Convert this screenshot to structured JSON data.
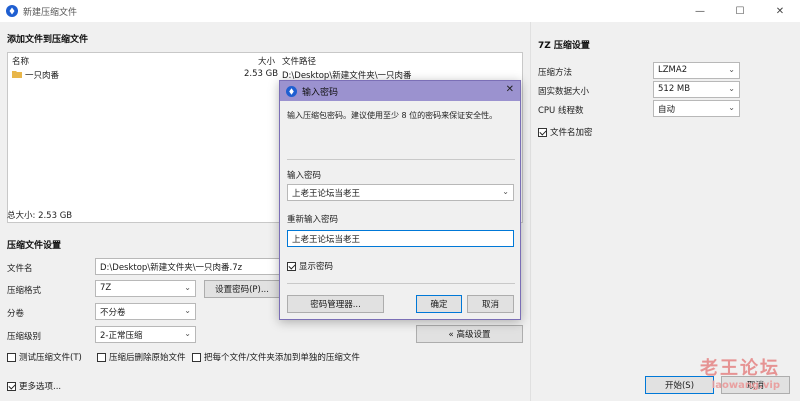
{
  "window": {
    "title": "新建压缩文件",
    "minimize": "—",
    "maximize": "☐",
    "close": "✕"
  },
  "files": {
    "section_title": "添加文件到压缩文件",
    "headers": {
      "name": "名称",
      "size": "大小",
      "path": "文件路径"
    },
    "rows": [
      {
        "name": "一只肉番",
        "size": "2.53 GB",
        "path": "D:\\Desktop\\新建文件夹\\一只肉番"
      }
    ],
    "total_size": "总大小: 2.53 GB"
  },
  "settings": {
    "section_title": "压缩文件设置",
    "filename_label": "文件名",
    "filename_value": "D:\\Desktop\\新建文件夹\\一只肉番.7z",
    "format_label": "压缩格式",
    "format_value": "7Z",
    "set_password_button": "设置密码(P)...",
    "split_label": "分卷",
    "split_value": "不分卷",
    "level_label": "压缩级别",
    "level_value": "2-正常压缩",
    "advanced_button": "« 高级设置",
    "test_archive": "测试压缩文件(T)",
    "delete_after": "压缩后删除原始文件",
    "each_separate": "把每个文件/文件夹添加到单独的压缩文件"
  },
  "bottom": {
    "more_options": "更多选项...",
    "start_button": "开始(S)",
    "cancel_button": "取消"
  },
  "sevenz": {
    "section_title": "7Z 压缩设置",
    "method_label": "压缩方法",
    "method_value": "LZMA2",
    "dict_label": "固实数据大小",
    "dict_value": "512 MB",
    "cpu_label": "CPU 线程数",
    "cpu_value": "自动",
    "encrypt_names": "文件名加密"
  },
  "dialog": {
    "title": "输入密码",
    "hint": "输入压缩包密码。建议使用至少 8 位的密码来保证安全性。",
    "password_label": "输入密码",
    "password_value": "上老王论坛当老王",
    "reenter_label": "重新输入密码",
    "reenter_value": "上老王论坛当老王",
    "show_password": "显示密码",
    "manager_button": "密码管理器...",
    "ok_button": "确定",
    "cancel_button": "取消",
    "close": "✕"
  },
  "watermark": {
    "line1": "老王论坛",
    "line2": "laowang.vip"
  },
  "colors": {
    "dialog_title": "#9b92cf",
    "accent": "#0078d7",
    "watermark": "#e58a8a"
  }
}
